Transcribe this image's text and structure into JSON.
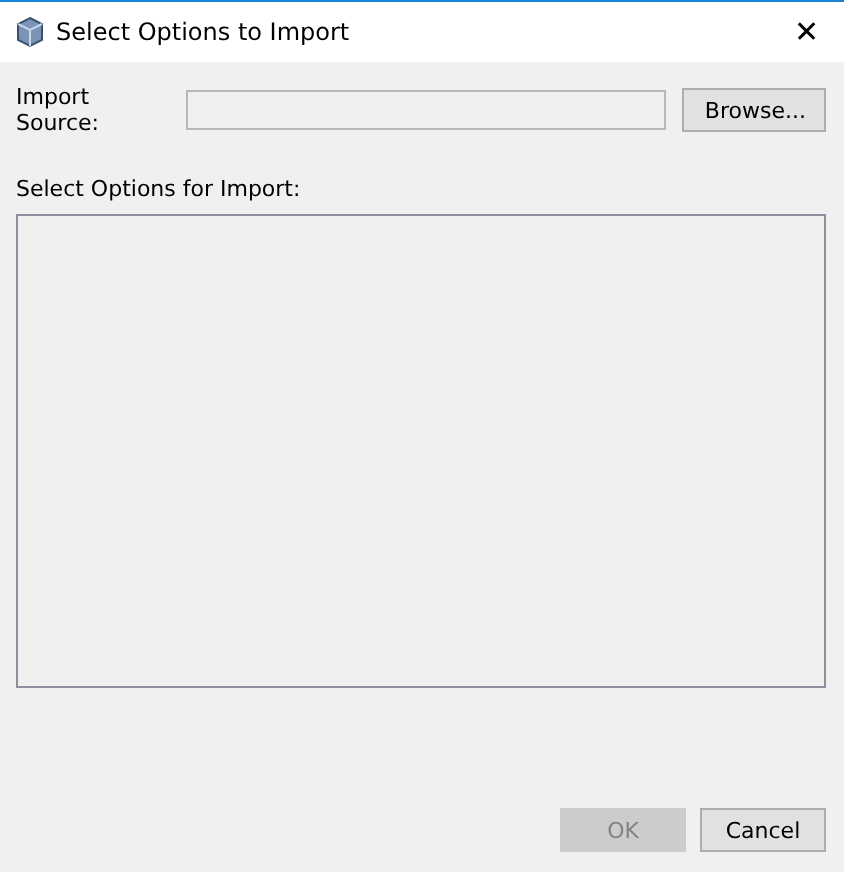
{
  "window": {
    "title": "Select Options to Import",
    "close": "✕"
  },
  "import_source": {
    "label": "Import Source:",
    "browse": "Browse..."
  },
  "options": {
    "label": "Select Options for Import:"
  },
  "buttons": [
    {
      "label": "OK",
      "disabled": true
    },
    {
      "label": "Cancel",
      "disabled": false
    }
  ]
}
